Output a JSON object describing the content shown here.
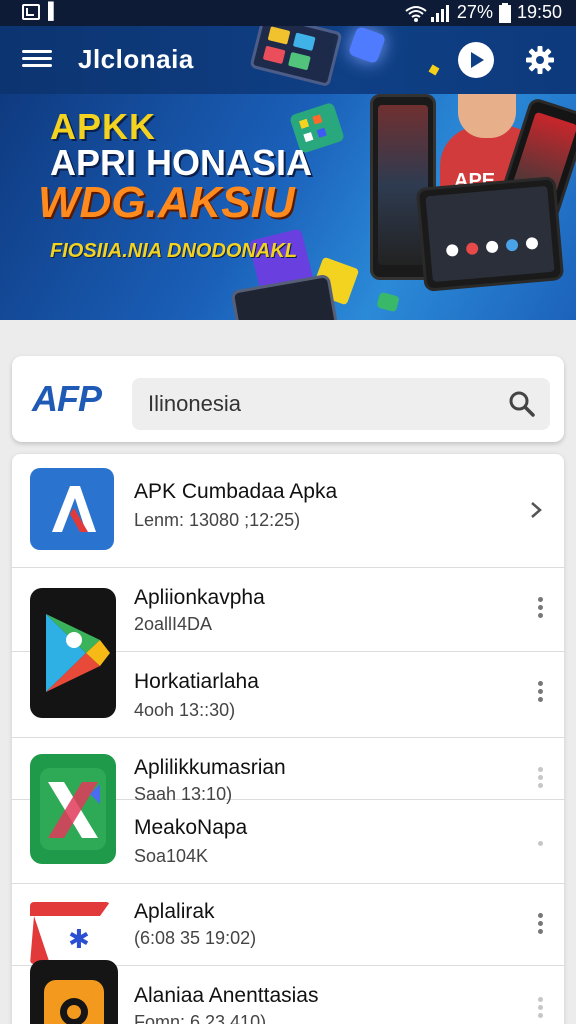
{
  "status_bar": {
    "battery": "27%",
    "time": "19:50"
  },
  "app_bar": {
    "title": "Jlclonaia"
  },
  "banner": {
    "line1": "APKK",
    "line2": "APRI HONASIA",
    "line3": "WDG.AKSIU",
    "line4": "FIOSIIA.NIA DNODONAKL",
    "hoodie_text": "APE"
  },
  "search": {
    "logo": "AFP",
    "value": "Ilinonesia"
  },
  "list": [
    {
      "title": "APK Cumbadaa Apka",
      "subtitle": "Lenm: 13080 ;12:25)"
    },
    {
      "title": "Apliionkavpha",
      "subtitle": "2oallI4DA"
    },
    {
      "title": "Horkatiarlaha",
      "subtitle": "4ooh 13::30)"
    },
    {
      "title": "Aplilikkumasrian",
      "subtitle": "Saah 13:10)"
    },
    {
      "title": "MeakoNapa",
      "subtitle": "Soa104K"
    },
    {
      "title": "Aplalirak",
      "subtitle": "(6:08 35 19:02)"
    },
    {
      "title": "Alaniaa Anenttasias",
      "subtitle": "Fomn: 6 23 410)"
    }
  ],
  "colors": {
    "primary": "#0f3f85",
    "accent_orange": "#ff8a1e",
    "accent_yellow": "#f3d320"
  }
}
